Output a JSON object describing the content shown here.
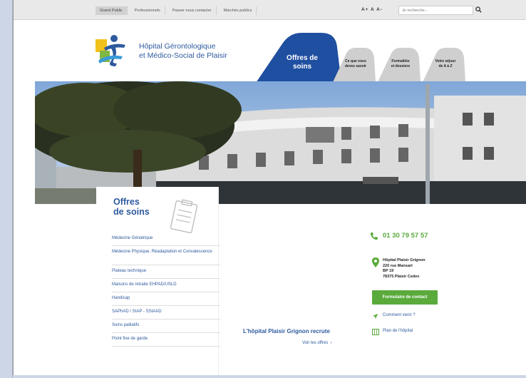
{
  "topbar": {
    "nav": [
      "Grand Public",
      "Professionnels",
      "Passer nous contacter",
      "Marchés publics"
    ],
    "font_size": "A+ A A-",
    "search_placeholder": "Je recherche..."
  },
  "header": {
    "logo_line1": "Hôpital Gérontologique",
    "logo_line2": "et Médico-Social de Plaisir",
    "tabs": [
      {
        "label_line1": "Offres de",
        "label_line2": "soins"
      },
      {
        "label_line1": "Ce que vous",
        "label_line2": "devez savoir"
      },
      {
        "label_line1": "Formalités",
        "label_line2": "et dossiers"
      },
      {
        "label_line1": "Votre séjour",
        "label_line2": "de A à Z"
      }
    ]
  },
  "panel": {
    "title_line1": "Offres",
    "title_line2": "de soins",
    "items": [
      "Médecine Gériatrique",
      "Médecine Physique, Réadaptation et Convalescence",
      "Plateau technique",
      "Maisons de retraite EHPAD/USLD",
      "Handicap",
      "SAPhAD / SIAP - SSIAAD",
      "Soins palliatifs",
      "Point fixe de garde"
    ]
  },
  "center": {
    "title": "L'hôpital Plaisir Grignon recrute",
    "link": "Voir les offres"
  },
  "contact": {
    "phone": "01 30 79 57 57",
    "address": [
      "Hôpital Plaisir Grignon",
      "220 rue Mansart",
      "BP 19",
      "78375 Plaisir Cedex"
    ],
    "button": "Formulaire de contact",
    "link1": "Comment venir ?",
    "link2": "Plan de l'hôpital"
  },
  "colors": {
    "brand_blue": "#1f4fa0",
    "green": "#5aaa3c",
    "gray_tab": "#cfcfcf"
  }
}
